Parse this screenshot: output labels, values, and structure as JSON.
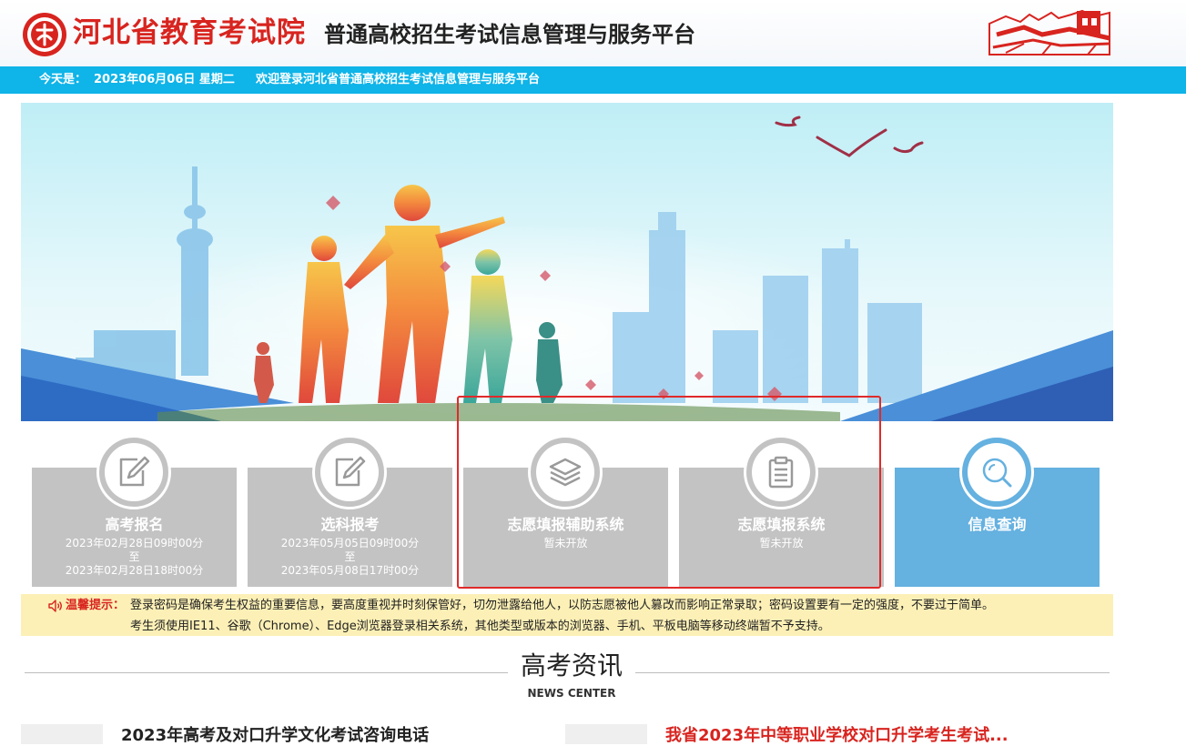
{
  "header": {
    "org_name": "河北省教育考试院",
    "platform_name": "普通高校招生考试信息管理与服务平台"
  },
  "datebar": {
    "date_label": "今天是：",
    "date_value": "2023年06月06日 星期二",
    "welcome": "欢迎登录河北省普通高校招生考试信息管理与服务平台"
  },
  "tiles": [
    {
      "title": "高考报名",
      "line1": "2023年02月28日09时00分",
      "line2": "至",
      "line3": "2023年02月28日18时00分",
      "icon": "edit-icon",
      "color": "#c3c3c3"
    },
    {
      "title": "选科报考",
      "line1": "2023年05月05日09时00分",
      "line2": "至",
      "line3": "2023年05月08日17时00分",
      "icon": "edit-icon",
      "color": "#c3c3c3"
    },
    {
      "title": "志愿填报辅助系统",
      "line1": "暂未开放",
      "icon": "layers-icon",
      "color": "#c3c3c3"
    },
    {
      "title": "志愿填报系统",
      "line1": "暂未开放",
      "icon": "clipboard-icon",
      "color": "#c3c3c3"
    },
    {
      "title": "信息查询",
      "icon": "search-icon",
      "color": "#65b1e0"
    }
  ],
  "notice": {
    "label": "温馨提示：",
    "line1": "登录密码是确保考生权益的重要信息，要高度重视并时刻保管好，切勿泄露给他人，以防志愿被他人篡改而影响正常录取；密码设置要有一定的强度，不要过于简单。",
    "line2": "考生须使用IE11、谷歌（Chrome）、Edge浏览器登录相关系统，其他类型或版本的浏览器、手机、平板电脑等移动终端暂不予支持。"
  },
  "news": {
    "title": "高考资讯",
    "subtitle": "NEWS CENTER",
    "items": [
      {
        "text": "2023年高考及对口升学文化考试咨询电话",
        "color": "#222222"
      },
      {
        "text": "我省2023年中等职业学校对口升学考生考试...",
        "color": "#d8241f"
      }
    ]
  },
  "colors": {
    "brand_red": "#d8241f",
    "bar_blue": "#0fb4e8",
    "tile_gray": "#c3c3c3",
    "tile_blue": "#65b1e0",
    "notice_bg": "#fcf0b6",
    "highlight_red": "#e02a2a"
  }
}
